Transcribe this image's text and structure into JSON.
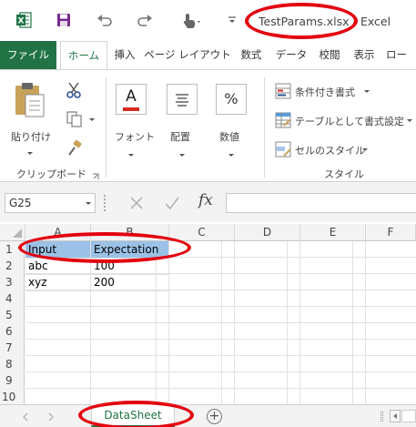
{
  "titlebar": {
    "title": "TestParams.xlsx - Excel"
  },
  "tabs": [
    {
      "label": "ファイル",
      "selected": false
    },
    {
      "label": "ホーム",
      "selected": true
    },
    {
      "label": "挿入",
      "selected": false
    },
    {
      "label": "ページ レイアウト",
      "selected": false
    },
    {
      "label": "数式",
      "selected": false
    },
    {
      "label": "データ",
      "selected": false
    },
    {
      "label": "校閲",
      "selected": false
    },
    {
      "label": "表示",
      "selected": false
    },
    {
      "label": "ロー",
      "selected": false
    }
  ],
  "ribbon": {
    "clipboard": {
      "paste_label": "貼り付け",
      "group_label": "クリップボード"
    },
    "font": {
      "label": "フォント",
      "icon_text": "A"
    },
    "alignment": {
      "label": "配置"
    },
    "number": {
      "label": "数値",
      "icon_text": "%"
    },
    "styles": {
      "conditional_label": "条件付き書式",
      "table_label": "テーブルとして書式設定",
      "cell_styles_label": "セルのスタイル",
      "group_label": "スタイル"
    }
  },
  "formula_bar": {
    "name_box": "G25",
    "fx_label": "fx",
    "formula": ""
  },
  "sheet": {
    "columns": [
      "A",
      "B",
      "C",
      "D",
      "E",
      "F"
    ],
    "rows": [
      "1",
      "2",
      "3",
      "4",
      "5",
      "6",
      "7",
      "8",
      "9",
      "10"
    ],
    "cells": {
      "A1": "Input",
      "B1": "Expectation",
      "A2": "abc",
      "B2": "100",
      "A3": "xyz",
      "B3": "200"
    }
  },
  "sheet_tabs": {
    "active": "DataSheet",
    "add_label": "+"
  },
  "colors": {
    "accent": "#217346",
    "header_highlight": "#9bc2e6",
    "annotation": "#e3000f"
  }
}
